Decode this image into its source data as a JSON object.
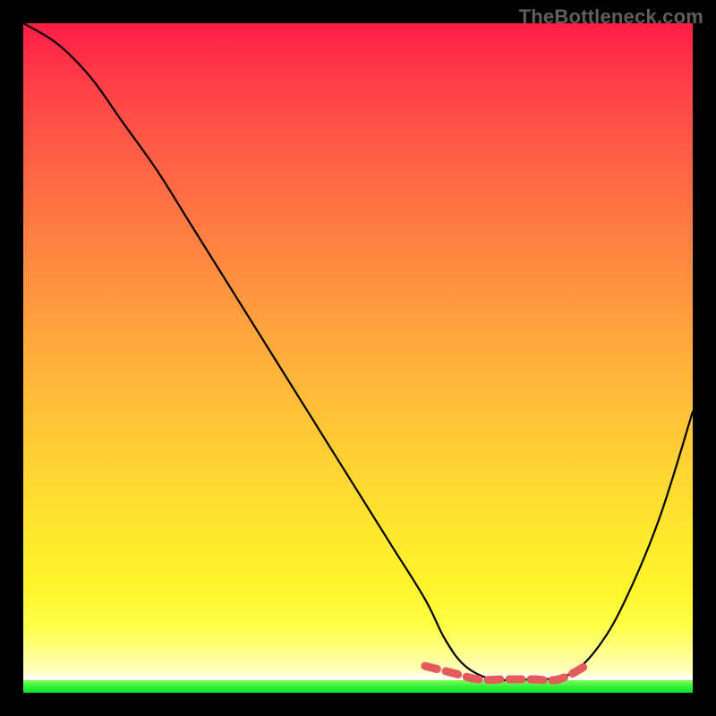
{
  "watermark": "TheBottleneck.com",
  "chart_data": {
    "type": "line",
    "title": "",
    "xlabel": "",
    "ylabel": "",
    "xlim": [
      0,
      100
    ],
    "ylim": [
      0,
      100
    ],
    "grid": false,
    "legend": false,
    "description": "Bottleneck/compatibility curve on a red-to-green vertical gradient. Lower y (near green) indicates optimal pairing. Curve descends from top-left, reaching a minimum near x≈70–80, then rises toward the right.",
    "series": [
      {
        "name": "bottleneck-curve",
        "x": [
          0,
          5,
          10,
          15,
          20,
          25,
          30,
          35,
          40,
          45,
          50,
          55,
          60,
          63,
          66,
          70,
          74,
          78,
          82,
          86,
          90,
          95,
          100
        ],
        "values": [
          100,
          97,
          92,
          85,
          78,
          70,
          62,
          54,
          46,
          38,
          30,
          22,
          14,
          8,
          4,
          2,
          2,
          2,
          3,
          7,
          14,
          26,
          42
        ]
      },
      {
        "name": "optimal-range-marker",
        "x": [
          60,
          64,
          68,
          72,
          76,
          80,
          84
        ],
        "values": [
          4,
          3,
          2,
          2,
          2,
          2,
          4
        ]
      }
    ],
    "gradient_stops": [
      {
        "pos": 0.0,
        "color": "#ff1d47"
      },
      {
        "pos": 0.3,
        "color": "#ff7a42"
      },
      {
        "pos": 0.6,
        "color": "#ffd334"
      },
      {
        "pos": 0.85,
        "color": "#fff42c"
      },
      {
        "pos": 0.96,
        "color": "#ffffb0"
      },
      {
        "pos": 1.0,
        "color": "#00e629"
      }
    ]
  }
}
